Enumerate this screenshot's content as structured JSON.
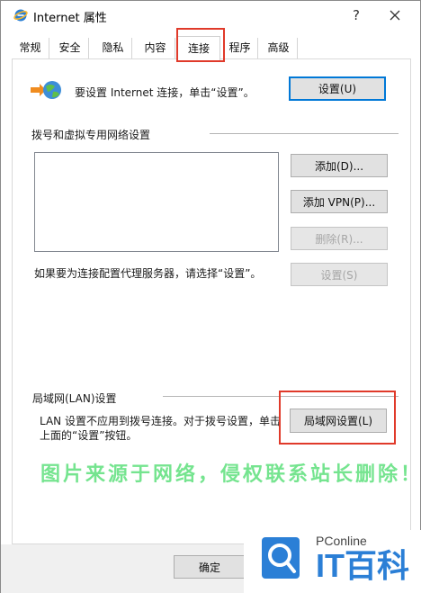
{
  "window": {
    "title": "Internet 属性",
    "help_glyph": "?"
  },
  "tabs": [
    {
      "label": "常规"
    },
    {
      "label": "安全"
    },
    {
      "label": "隐私"
    },
    {
      "label": "内容"
    },
    {
      "label": "连接"
    },
    {
      "label": "程序"
    },
    {
      "label": "高级"
    }
  ],
  "active_tab": "连接",
  "setup": {
    "text": "要设置 Internet 连接，单击“设置”。",
    "button": "设置(U)"
  },
  "dialup": {
    "group_label": "拨号和虚拟专用网络设置",
    "add_button": "添加(D)...",
    "add_vpn_button": "添加 VPN(P)...",
    "remove_button": "删除(R)...",
    "proxy_text": "如果要为连接配置代理服务器，请选择“设置”。",
    "settings_button": "设置(S)"
  },
  "lan": {
    "group_label": "局域网(LAN)设置",
    "text": "LAN 设置不应用到拨号连接。对于拨号设置，单击上面的“设置”按钮。",
    "button": "局域网设置(L)"
  },
  "footer": {
    "ok_button": "确定"
  },
  "watermark": "图片来源于网络，侵权联系站长删除！",
  "logo": {
    "sub": "PConline",
    "main": "IT百科"
  },
  "colors": {
    "highlight": "#e03a2a",
    "accent": "#0078d7",
    "watermark": "#5ee07c",
    "logo": "#2b7fd6"
  }
}
